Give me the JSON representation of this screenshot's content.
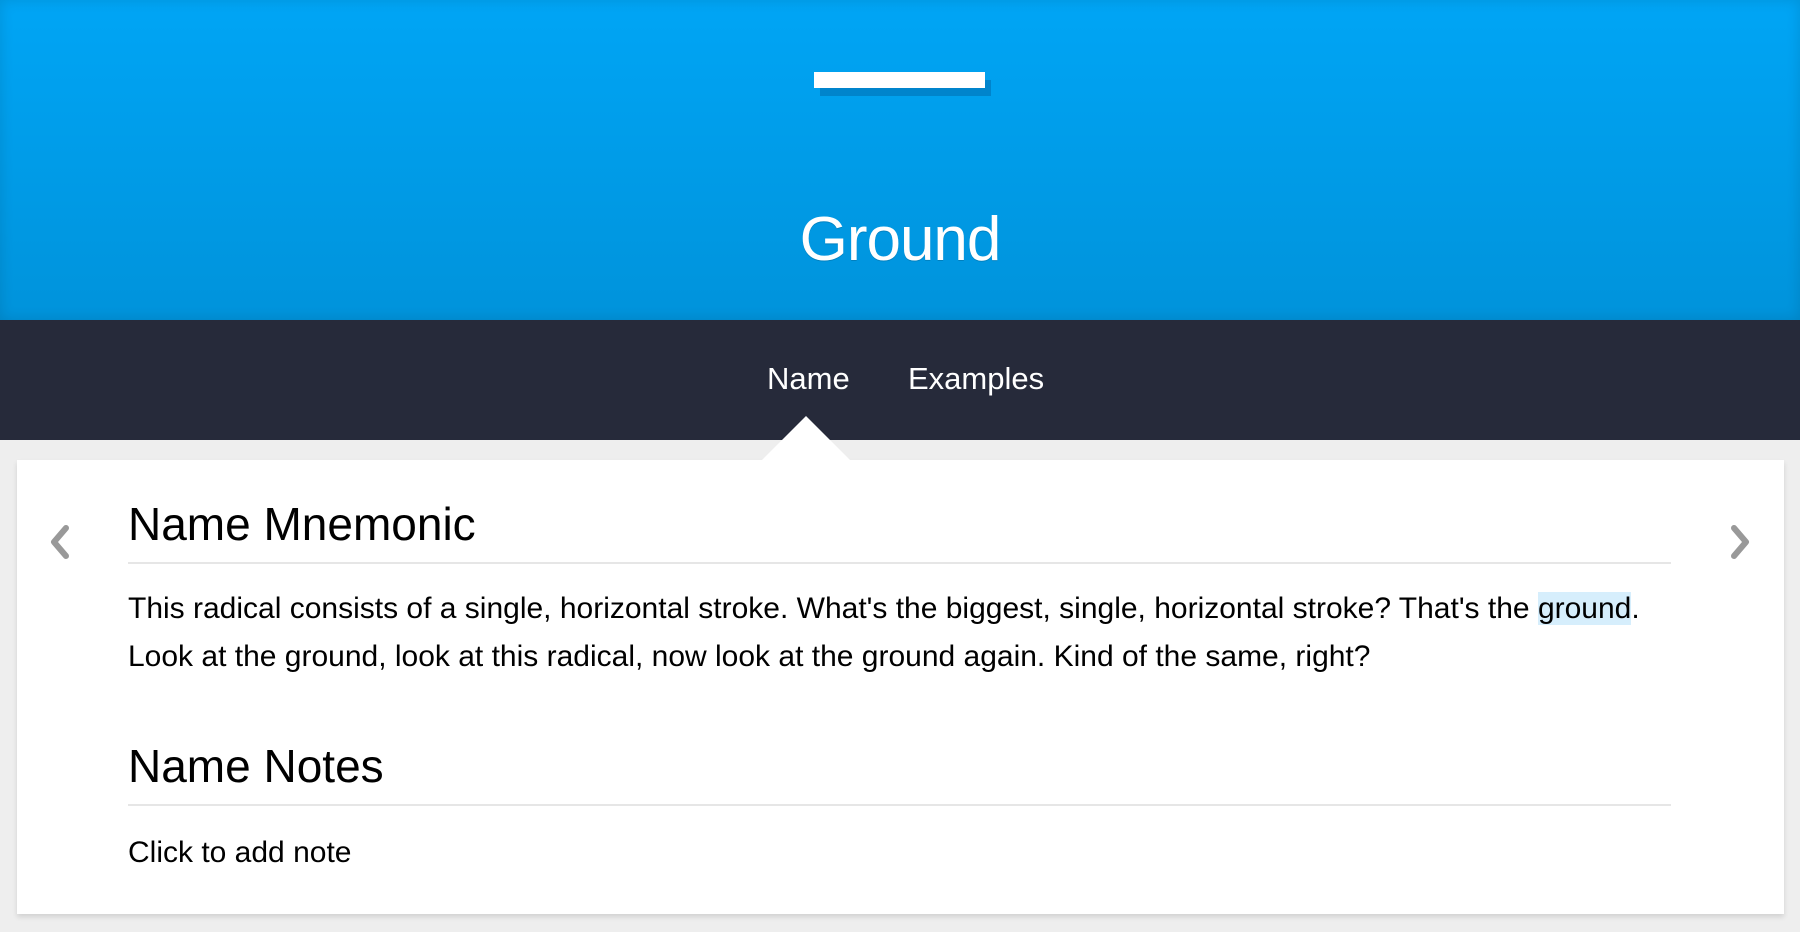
{
  "subject": {
    "title": "Ground"
  },
  "tabs": [
    {
      "label": "Name"
    },
    {
      "label": "Examples"
    }
  ],
  "name_mnemonic": {
    "heading": "Name Mnemonic",
    "text_before": "This radical consists of a single, horizontal stroke. What's the biggest, single, horizontal stroke? That's the ",
    "highlight": "ground",
    "text_after": ". Look at the ground, look at this radical, now look at the ground again. Kind of the same, right?"
  },
  "name_notes": {
    "heading": "Name Notes",
    "placeholder": "Click to add note"
  },
  "icons": {
    "prev": "chevron-left-icon",
    "next": "chevron-right-icon"
  },
  "colors": {
    "header_top": "#00a5f5",
    "header_bottom": "#0093db",
    "tabbar": "#262a3a",
    "highlight": "#d6eefc"
  }
}
